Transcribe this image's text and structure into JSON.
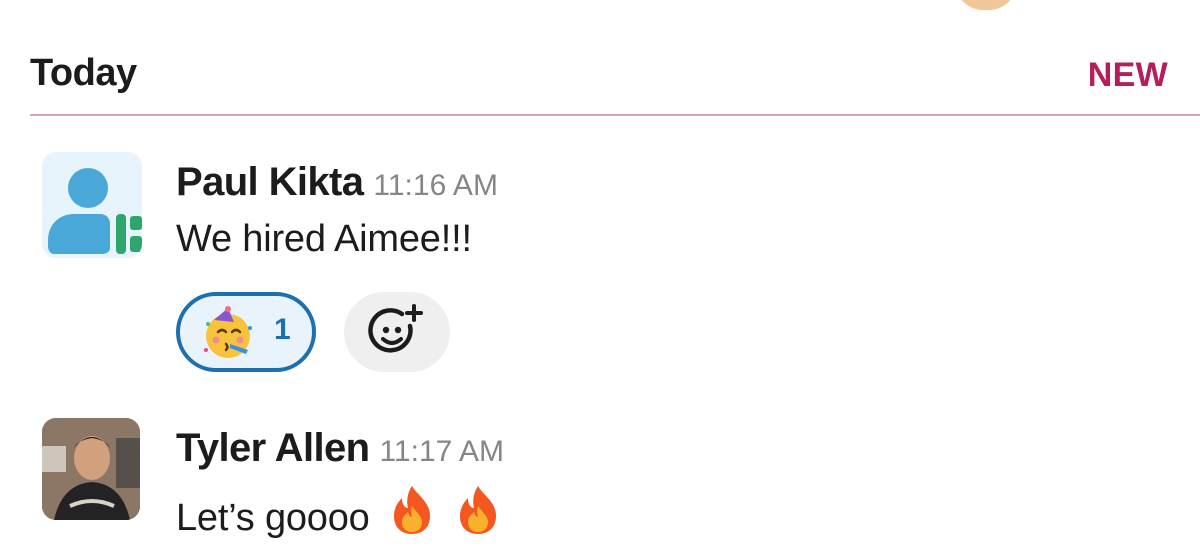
{
  "header": {
    "day_label": "Today",
    "new_marker": "NEW"
  },
  "colors": {
    "new_marker": "#b51e5b",
    "reaction_accent": "#1d6fb0",
    "timestamp": "#868686"
  },
  "messages": [
    {
      "sender": "Paul Kikta",
      "time": "11:16 AM",
      "text": "We hired Aimee!!!",
      "avatar_icon": "generic-user-avatar-icon",
      "reactions": [
        {
          "icon": "partying-face-icon",
          "count": "1",
          "selected": true
        }
      ],
      "add_reaction_icon": "add-emoji-icon"
    },
    {
      "sender": "Tyler Allen",
      "time": "11:17 AM",
      "text": "Let’s goooo",
      "avatar_icon": "user-photo-avatar",
      "inline_emoji": [
        "fire-icon",
        "fire-icon"
      ]
    }
  ]
}
